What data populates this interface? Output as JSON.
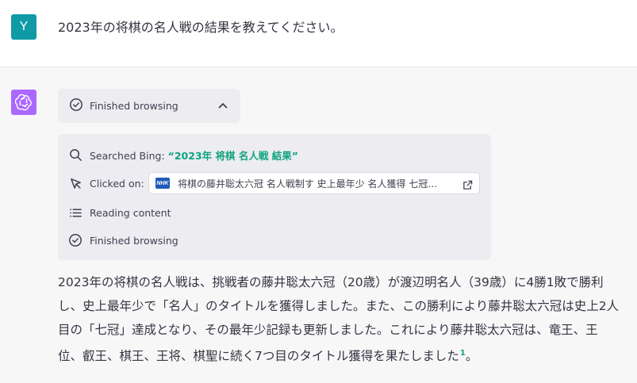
{
  "user": {
    "avatar_letter": "Y",
    "message": "2023年の将棋の名人戦の結果を教えてください。"
  },
  "assistant": {
    "avatar_icon": "openai-logo-icon",
    "browsing": {
      "toggle_label": "Finished browsing",
      "toggle_icon": "chevron-up-icon",
      "steps": {
        "search_prefix": "Searched Bing: ",
        "search_query": "“2023年 将棋 名人戦 結果”",
        "clicked_label": "Clicked on:",
        "clicked_link": "将棋の藤井聡太六冠 名人戦制す 史上最年少 名人獲得 七冠…",
        "clicked_favicon": "NHK",
        "reading": "Reading content",
        "finished": "Finished browsing"
      }
    },
    "answer": "2023年の将棋の名人戦は、挑戦者の藤井聡太六冠（20歳）が渡辺明名人（39歳）に4勝1敗で勝利し、史上最年少で「名人」のタイトルを獲得しました。また、この勝利により藤井聡太六冠は史上2人目の「七冠」達成となり、その最年少記録も更新しました。これにより藤井聡太六冠は、竜王、王位、叡王、棋王、王将、棋聖に続く7つ目のタイトル獲得を果たしました",
    "citation": "1",
    "answer_end": "。"
  },
  "colors": {
    "user_avatar": "#0f9aa6",
    "assistant_avatar": "#ab68ff",
    "accent": "#10a37f",
    "panel": "#ececf1"
  }
}
